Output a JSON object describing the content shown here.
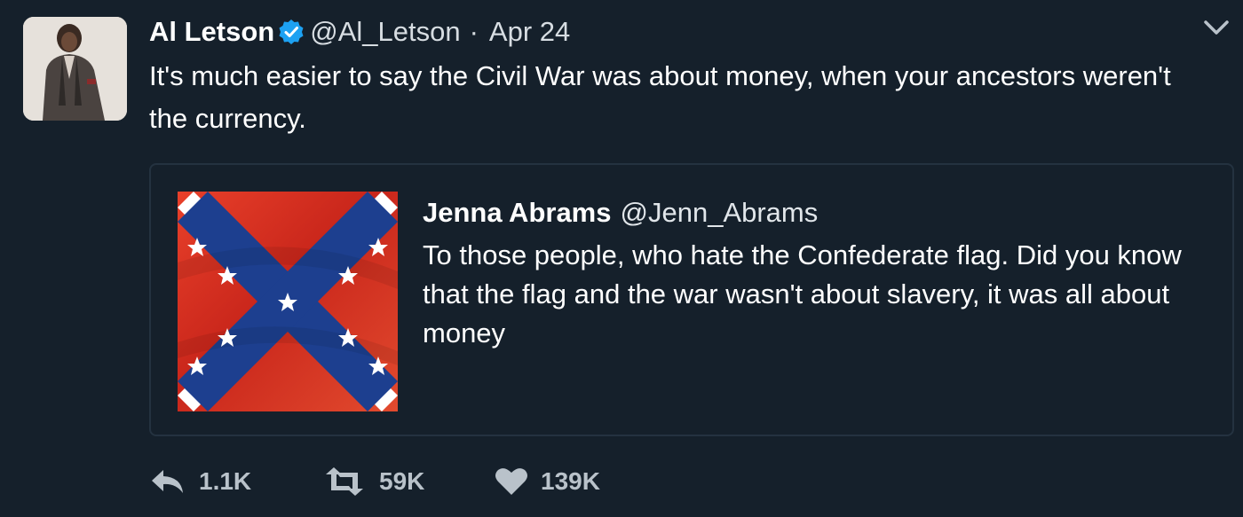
{
  "author": {
    "name": "Al Letson",
    "handle": "@Al_Letson",
    "separator": "·",
    "date": "Apr 24"
  },
  "tweet": {
    "text": "It's much easier to say the Civil War was about money, when your ancestors weren't the currency."
  },
  "quoted": {
    "name": "Jenna Abrams",
    "handle": "@Jenn_Abrams",
    "text": "To those people, who hate the Confederate flag. Did you know that the flag and the war wasn't about slavery, it was all about money"
  },
  "actions": {
    "replies": "1.1K",
    "retweets": "59K",
    "likes": "139K"
  },
  "icons": {
    "verified": "verified-badge-icon",
    "more": "chevron-down-icon",
    "reply": "reply-icon",
    "retweet": "retweet-icon",
    "like": "heart-icon"
  },
  "colors": {
    "background": "#15202b",
    "verified": "#1da1f2",
    "muted": "#b9c2ca"
  }
}
